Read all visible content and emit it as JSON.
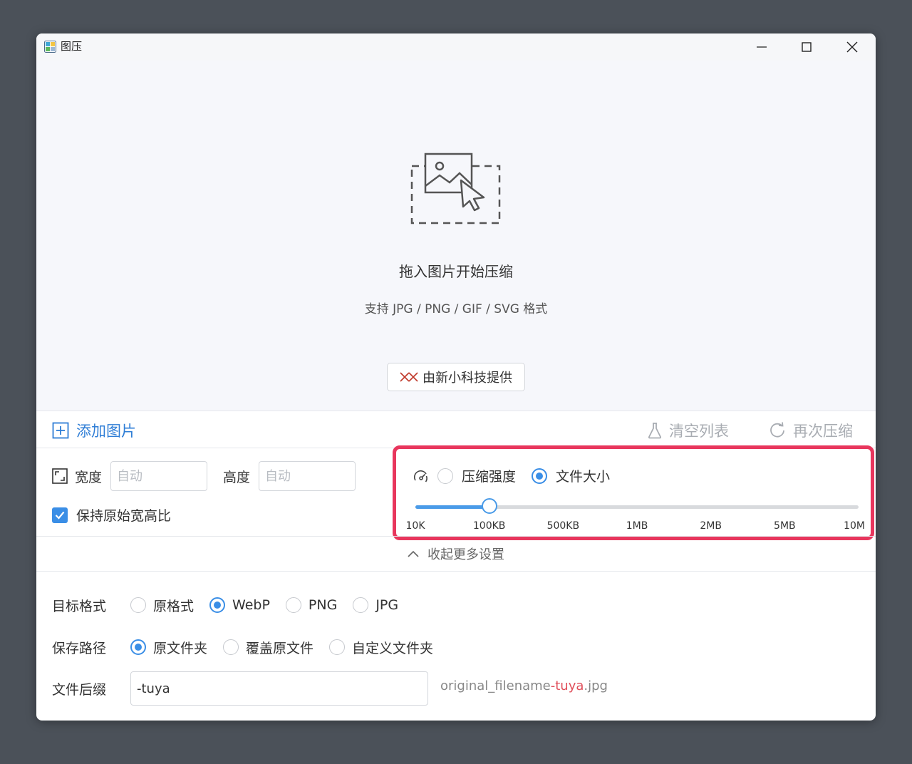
{
  "window": {
    "title": "图压"
  },
  "dropzone": {
    "title": "拖入图片开始压缩",
    "subtitle": "支持 JPG / PNG / GIF / SVG 格式",
    "provider_label": "由新小科技提供"
  },
  "toolbar": {
    "add_label": "添加图片",
    "clear_label": "清空列表",
    "recompress_label": "再次压缩"
  },
  "size": {
    "width_label": "宽度",
    "width_placeholder": "自动",
    "height_label": "高度",
    "height_placeholder": "自动",
    "keep_ratio_label": "保持原始宽高比",
    "keep_ratio_checked": true
  },
  "mode": {
    "options": [
      {
        "label": "压缩强度",
        "selected": false
      },
      {
        "label": "文件大小",
        "selected": true
      }
    ],
    "slider": {
      "ticks": [
        "10K",
        "100KB",
        "500KB",
        "1MB",
        "2MB",
        "5MB",
        "10M"
      ],
      "value": "100KB",
      "value_fraction": 0.167
    }
  },
  "collapse_label": "收起更多设置",
  "format": {
    "label": "目标格式",
    "options": [
      "原格式",
      "WebP",
      "PNG",
      "JPG"
    ],
    "selected": "WebP"
  },
  "save_path": {
    "label": "保存路径",
    "options": [
      "原文件夹",
      "覆盖原文件",
      "自定义文件夹"
    ],
    "selected": "原文件夹"
  },
  "suffix": {
    "label": "文件后缀",
    "value": "-tuya",
    "preview_prefix": "original_filename",
    "preview_suffix": "-tuya",
    "preview_ext": ".jpg"
  },
  "colors": {
    "accent": "#3a8ee6",
    "highlight_border": "#e8365d",
    "provider_logo": "#c0392b"
  }
}
